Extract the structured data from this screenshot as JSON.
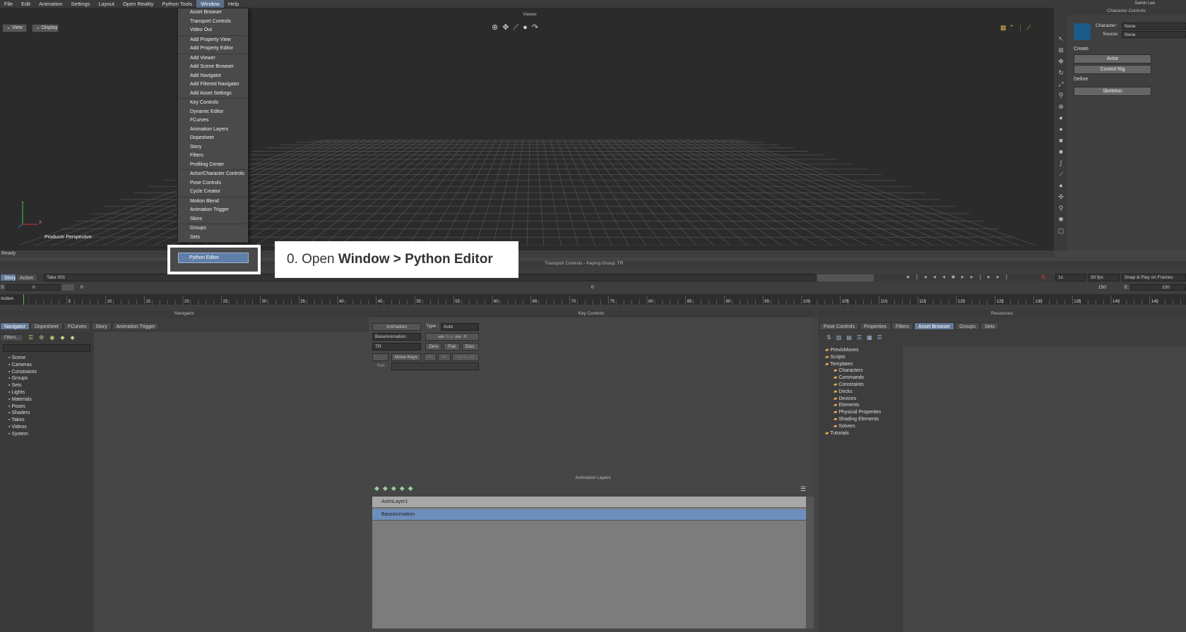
{
  "menubar": [
    "File",
    "Edit",
    "Animation",
    "Settings",
    "Layout",
    "Open Reality",
    "Python Tools",
    "Window",
    "Help"
  ],
  "user": "Samin Lee",
  "viewer": {
    "title": "Viewer",
    "view_btn": "View",
    "display_btn": "Display",
    "camera": "Producer Perspective",
    "status": "Ready",
    "axis_y": "Y",
    "axis_x": "X"
  },
  "window_menu": [
    "Asset Browser",
    "Transport Controls",
    "Video Out",
    "Add Property View",
    "Add Property Editor",
    "Add Viewer",
    "Add Scene Browser",
    "Add Navigator",
    "Add Filtered Navigator",
    "Add Asset Settings",
    "Key Controls",
    "Dynamic Editor",
    "FCurves",
    "Animation Layers",
    "Dopesheet",
    "Story",
    "Filters",
    "Profiling Center",
    "Actor/Character Controls",
    "Pose Controls",
    "Cycle Creator",
    "Motion Blend",
    "Animation Trigger",
    "Skins",
    "Groups",
    "Sets"
  ],
  "python_editor": "Python Editor",
  "callout": {
    "prefix": "0. Open ",
    "bold": "Window > Python Editor"
  },
  "character_controls": {
    "title": "Character Controls",
    "character_label": "Character:",
    "character_value": "None",
    "source_label": "Source:",
    "source_value": "None",
    "create": "Create",
    "actor_btn": "Actor",
    "control_rig_btn": "Control Rig",
    "define": "Define",
    "skeleton_btn": "Skeleton"
  },
  "transport": {
    "title": "Transport Controls - Keying Group: TR",
    "story_tab": "Story",
    "action_tab": "Action",
    "take": "Take 001",
    "speed": "1x",
    "fps": "30 fps",
    "snap": "Snap & Play on Frames",
    "start_label": "S:",
    "start": "0",
    "frame": "0",
    "end_label": "E:",
    "end": "150",
    "end_field": "150",
    "timeline_label": "Action",
    "ticks": [
      "5",
      "10",
      "15",
      "20",
      "25",
      "30",
      "35",
      "40",
      "45",
      "50",
      "55",
      "60",
      "65",
      "70",
      "75",
      "80",
      "85",
      "90",
      "95",
      "100",
      "105",
      "110",
      "115",
      "120",
      "125",
      "130",
      "135",
      "140",
      "145"
    ]
  },
  "navigator": {
    "title": "Navigator",
    "tabs": [
      "Navigator",
      "Dopesheet",
      "FCurves",
      "Story",
      "Animation Trigger"
    ],
    "filter": "Filters...",
    "tree": [
      "Scene",
      "Cameras",
      "Constraints",
      "Groups",
      "Sets",
      "Lights",
      "Materials",
      "Poses",
      "Shaders",
      "Takes",
      "Videos",
      "System"
    ]
  },
  "key_controls": {
    "title": "Key Controls",
    "animation": "Animation",
    "type_label": "Type :",
    "type_value": "Auto",
    "layer": "BaseAnimation",
    "group": "TR",
    "key_label": "Key",
    "zero": "Zero",
    "flat": "Flat",
    "disc": "Disc.",
    "move_keys": "Move Keys",
    "fk": "FK",
    "ik": "IK",
    "sync": "Sync. All",
    "ref": "Ref.:"
  },
  "anim_layers": {
    "title": "Animation Layers",
    "layers": [
      "AnimLayer1",
      "BaseAnimation"
    ]
  },
  "resources": {
    "title": "Resources",
    "tabs": [
      "Pose Controls",
      "Properties",
      "Filters",
      "Asset Browser",
      "Groups",
      "Sets"
    ],
    "tree": [
      "PrevisMoves",
      "Scripts",
      "Templates",
      "Characters",
      "Commands",
      "Constraints",
      "Decks",
      "Devices",
      "Elements",
      "Physical Properties",
      "Shading Elements",
      "Solvers",
      "Tutorials"
    ]
  }
}
